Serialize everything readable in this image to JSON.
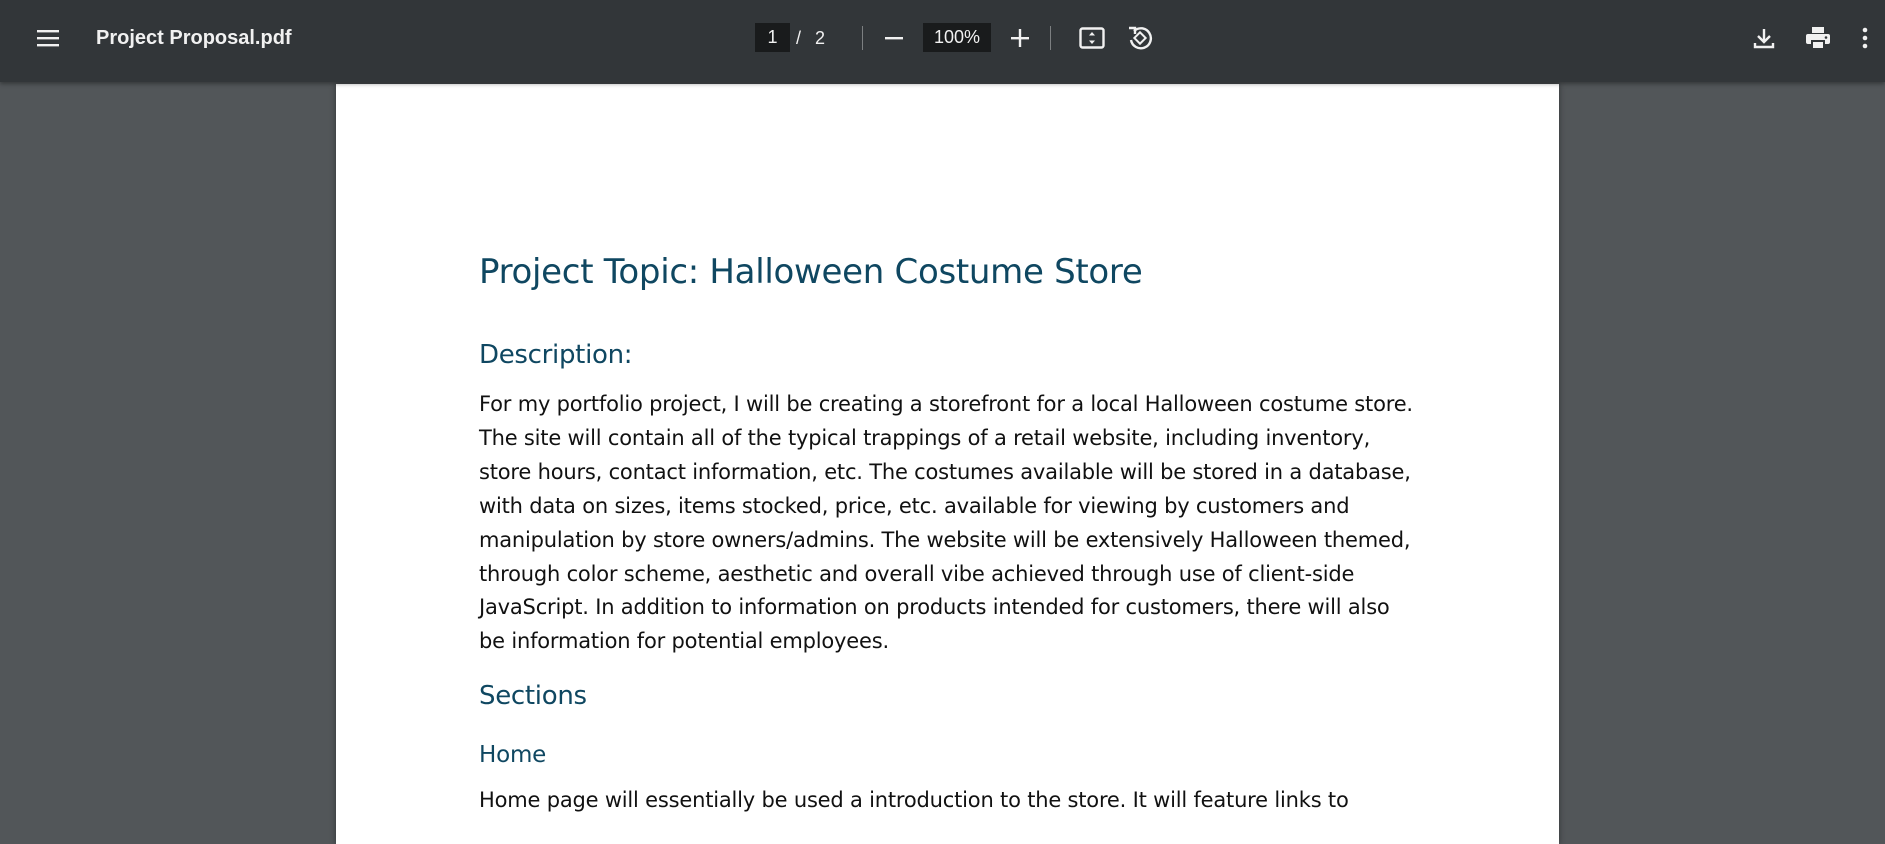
{
  "toolbar": {
    "file_name": "Project Proposal.pdf",
    "current_page": "1",
    "page_separator": "/",
    "total_pages": "2",
    "zoom_value": "100%",
    "icons": {
      "menu": "hamburger-menu-icon",
      "zoom_out": "minus-icon",
      "zoom_in": "plus-icon",
      "fit": "fit-to-page-icon",
      "rotate": "rotate-counterclockwise-icon",
      "download": "download-icon",
      "print": "print-icon",
      "more": "more-vertical-icon"
    }
  },
  "document": {
    "title": "Project Topic: Halloween Costume Store",
    "description_heading": "Description:",
    "description_text": "For my portfolio project, I will be creating a storefront for a local Halloween costume store. The site will contain all of the typical trappings of a retail website, including inventory, store hours, contact information, etc. The costumes available will be stored in a database, with data on sizes, items stocked, price, etc. available for viewing by customers and manipulation by store owners/admins. The website will be extensively Halloween themed, through color scheme, aesthetic and overall vibe achieved through use of client-side JavaScript. In addition to information on products intended for customers, there will also be information for potential employees.",
    "sections_heading": "Sections",
    "home_heading": "Home",
    "home_text": "Home page will essentially be used a introduction to the store. It will feature links to"
  },
  "colors": {
    "toolbar_bg": "#323639",
    "viewer_bg": "#525659",
    "heading": "#0f4761",
    "page_bg": "#ffffff"
  }
}
